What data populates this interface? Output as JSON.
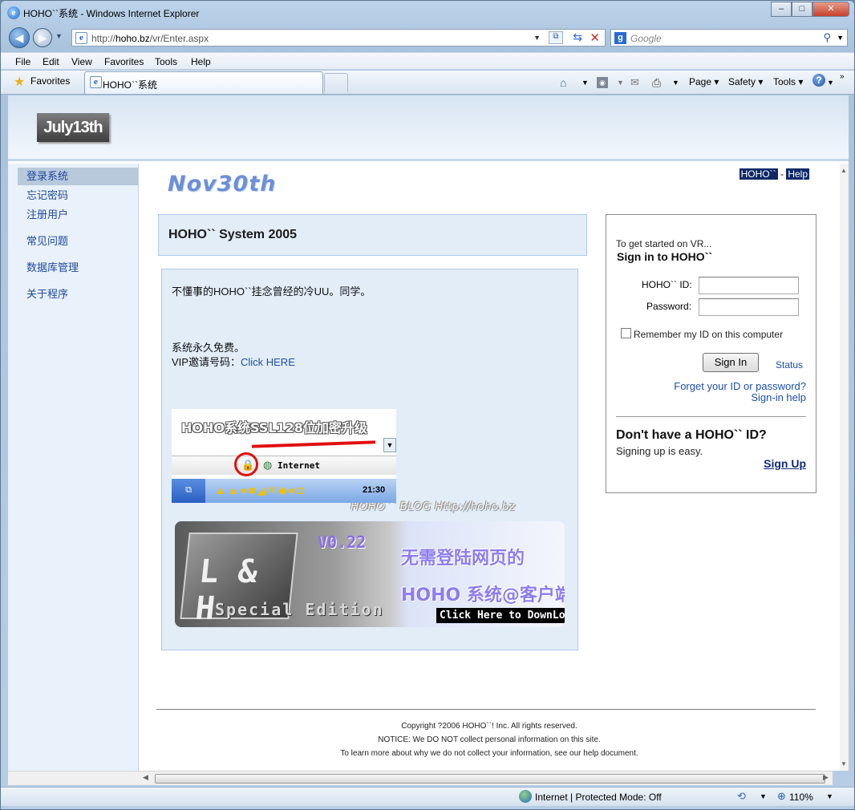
{
  "window": {
    "title": "HOHO``系统 - Windows Internet Explorer",
    "controls": {
      "minimize": "–",
      "maximize": "□",
      "close": "✕"
    }
  },
  "addressbar": {
    "url_prefix": "http://",
    "url_host": "hoho.bz",
    "url_path": "/vr/Enter.aspx",
    "search_placeholder": "Google"
  },
  "menu": [
    "File",
    "Edit",
    "View",
    "Favorites",
    "Tools",
    "Help"
  ],
  "favorites_bar": {
    "favorites_label": "Favorites",
    "tab_title": "HOHO``系统",
    "commands": {
      "page": "Page",
      "safety": "Safety",
      "tools": "Tools"
    }
  },
  "site": {
    "logo_text": "July13th",
    "brand_text": "Nov30th",
    "top_links": {
      "hoho": "HOHO``",
      "separator": "-",
      "help": "Help"
    }
  },
  "sidebar": {
    "items": [
      {
        "label": "登录系统",
        "active": true
      },
      {
        "label": "忘记密码"
      },
      {
        "label": "注册用户"
      },
      {
        "label": "常见问题"
      },
      {
        "label": "数据库管理"
      },
      {
        "label": "关于程序"
      }
    ]
  },
  "main": {
    "system_title": "HOHO`` System 2005",
    "intro_line": "不懂事的HOHO``挂念曾经的冷UU。同学。",
    "free_line": "系统永久免费。",
    "vip_label": "VIP邀请号码：",
    "vip_link": "Click HERE",
    "blog_watermark": "HOHO`` BLOG   Http://hoho.bz",
    "ssl_banner": {
      "title": "HOHO系统SSL128位加密升级",
      "status_text": "Internet",
      "clock": "21:30"
    },
    "download_banner": {
      "logo": "L & H",
      "edition": "Special Edition",
      "version": "V0.22",
      "line1": "无需登陆网页的",
      "line2": "HOHO 系统@客户端",
      "cta": "Click Here to DownLoad"
    }
  },
  "signin": {
    "intro": "To get started on VR...",
    "heading": "Sign in to HOHO``",
    "id_label": "HOHO`` ID:",
    "id_value": "",
    "password_label": "Password:",
    "password_value": "",
    "remember_label": "Remember my ID on this computer",
    "remember_checked": false,
    "signin_button": "Sign In",
    "status_link": "Status",
    "forgot_link": "Forget your ID or password?",
    "help_link": "Sign-in help",
    "no_id_heading": "Don't have a HOHO`` ID?",
    "signup_text": "Signing up is easy.",
    "signup_link": "Sign Up"
  },
  "footer": {
    "copyright": "Copyright ?2006 HOHO``! Inc. All rights reserved.",
    "notice": "NOTICE: We DO NOT collect personal information on this site.",
    "learn_more": "To learn more about why we do not collect your information, see our help document."
  },
  "statusbar": {
    "zone": "Internet | Protected Mode: Off",
    "zoom": "110%"
  },
  "colors": {
    "accent_link": "#1e4fa6",
    "panel_bg": "#e2edf8",
    "top_link_bg": "#0d2a66"
  }
}
